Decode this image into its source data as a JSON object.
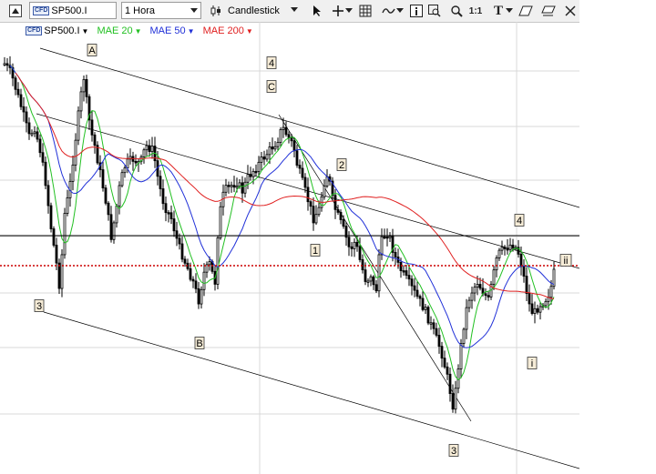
{
  "toolbar": {
    "symbol": "SP500.I",
    "timeframe": "1 Hora",
    "chart_style": "Candlestick",
    "icons": [
      "pointer-icon",
      "crosshair-icon",
      "grid-icon",
      "indicator-wave-icon",
      "info-icon",
      "zoom-area-icon",
      "magnifier-icon",
      "one-to-one-icon",
      "text-tool-icon",
      "eraser-icon",
      "trash-icon",
      "cross-tool-icon"
    ],
    "one_to_one_label": "1:1",
    "text_tool_label": "T"
  },
  "legend": {
    "badge": "CFD",
    "symbol": "SP500.I",
    "mae20": "MAE 20",
    "mae50": "MAE 50",
    "mae200": "MAE 200",
    "colors": {
      "symbol": "#000000",
      "mae20": "#22c022",
      "mae50": "#2030d8",
      "mae200": "#e02020"
    }
  },
  "wave_labels": [
    "A",
    "4",
    "C",
    "2",
    "1",
    "4",
    "ii",
    "3",
    "B",
    "i",
    "3"
  ],
  "colors": {
    "candle": "#000000",
    "mae20": "#22c022",
    "mae50": "#2030d8",
    "mae200": "#e02020",
    "channel": "#000000",
    "gridline": "#d8d8d8",
    "dotted_level": "#cc0000",
    "horizontal_level": "#000000"
  }
}
